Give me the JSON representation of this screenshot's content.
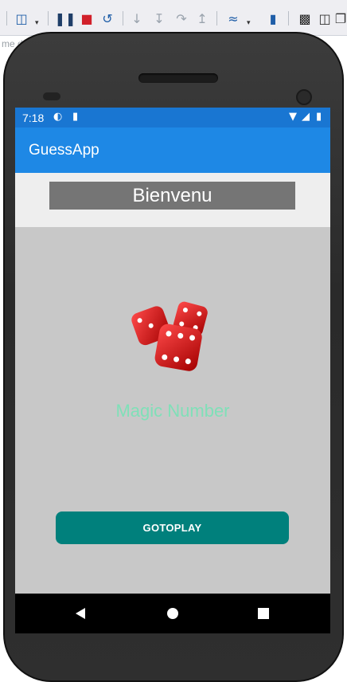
{
  "ide": {
    "breadcrumb": "me d",
    "toolbar_icons": [
      "window-layout-icon",
      "pause-icon",
      "stop-icon",
      "restart-icon",
      "step-into-icon",
      "step-over-icon",
      "step-back-icon",
      "step-out-icon",
      "hot-reload-icon",
      "device-icon",
      "terminal-icon",
      "layout-icon",
      "copy-icon"
    ]
  },
  "status_bar": {
    "time": "7:18",
    "icons": [
      "sync-icon",
      "sd-card-icon",
      "wifi-icon",
      "signal-icon",
      "battery-icon"
    ]
  },
  "app_bar": {
    "title": "GuessApp"
  },
  "header": {
    "banner_text": "Bienvenu"
  },
  "main": {
    "image": "dice-icon",
    "subtitle": "Magic Number",
    "button_label": "GOTOPLAY"
  },
  "nav_bar": {
    "buttons": [
      "back-icon",
      "home-icon",
      "recents-icon"
    ]
  },
  "colors": {
    "status_bar": "#1976d2",
    "app_bar": "#1e88e5",
    "banner": "#757575",
    "content_bg": "#c8c8c8",
    "subtitle": "#7fe0b8",
    "button": "#00807c"
  }
}
